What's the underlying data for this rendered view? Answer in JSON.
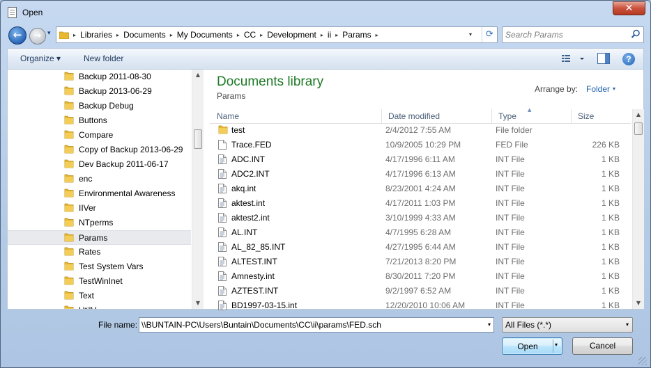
{
  "window": {
    "title": "Open",
    "close_label": "✕"
  },
  "nav": {
    "back_glyph": "←",
    "forward_glyph": "→",
    "recent_glyph": "▾",
    "refresh_glyph": "⟳",
    "dropdown_glyph": "▾"
  },
  "breadcrumb": [
    "Libraries",
    "Documents",
    "My Documents",
    "CC",
    "Development",
    "ii",
    "Params"
  ],
  "search": {
    "placeholder": "Search Params"
  },
  "toolbar": {
    "organize_label": "Organize ▾",
    "new_folder_label": "New folder",
    "help_label": "?"
  },
  "navpane": {
    "items": [
      "Backup 2011-08-30",
      "Backup 2013-06-29",
      "Backup Debug",
      "Buttons",
      "Compare",
      "Copy of Backup 2013-06-29",
      "Dev Backup 2011-06-17",
      "enc",
      "Environmental Awareness",
      "IIVer",
      "NTperms",
      "Params",
      "Rates",
      "Test System Vars",
      "TestWinInet",
      "Text",
      "UtilV..."
    ],
    "selected_index": 11
  },
  "library": {
    "title": "Documents library",
    "subtitle": "Params",
    "arrange_label": "Arrange by:",
    "arrange_value": "Folder"
  },
  "columns": {
    "name": "Name",
    "date": "Date modified",
    "type": "Type",
    "size": "Size"
  },
  "files": [
    {
      "name": "test",
      "date": "2/4/2012 7:55 AM",
      "type": "File folder",
      "size": "",
      "icon": "folder-icon"
    },
    {
      "name": "Trace.FED",
      "date": "10/9/2005 10:29 PM",
      "type": "FED File",
      "size": "226 KB",
      "icon": "blank-file-icon"
    },
    {
      "name": "ADC.INT",
      "date": "4/17/1996 6:11 AM",
      "type": "INT File",
      "size": "1 KB",
      "icon": "text-file-icon"
    },
    {
      "name": "ADC2.INT",
      "date": "4/17/1996 6:13 AM",
      "type": "INT File",
      "size": "1 KB",
      "icon": "text-file-icon"
    },
    {
      "name": "akq.int",
      "date": "8/23/2001 4:24 AM",
      "type": "INT File",
      "size": "1 KB",
      "icon": "text-file-icon"
    },
    {
      "name": "aktest.int",
      "date": "4/17/2011 1:03 PM",
      "type": "INT File",
      "size": "1 KB",
      "icon": "text-file-icon"
    },
    {
      "name": "aktest2.int",
      "date": "3/10/1999 4:33 AM",
      "type": "INT File",
      "size": "1 KB",
      "icon": "text-file-icon"
    },
    {
      "name": "AL.INT",
      "date": "4/7/1995 6:28 AM",
      "type": "INT File",
      "size": "1 KB",
      "icon": "text-file-icon"
    },
    {
      "name": "AL_82_85.INT",
      "date": "4/27/1995 6:44 AM",
      "type": "INT File",
      "size": "1 KB",
      "icon": "text-file-icon"
    },
    {
      "name": "ALTEST.INT",
      "date": "7/21/2013 8:20 PM",
      "type": "INT File",
      "size": "1 KB",
      "icon": "text-file-icon"
    },
    {
      "name": "Amnesty.int",
      "date": "8/30/2011 7:20 PM",
      "type": "INT File",
      "size": "1 KB",
      "icon": "text-file-icon"
    },
    {
      "name": "AZTEST.INT",
      "date": "9/2/1997 6:52 AM",
      "type": "INT File",
      "size": "1 KB",
      "icon": "text-file-icon"
    },
    {
      "name": "BD1997-03-15.int",
      "date": "12/20/2010 10:06 AM",
      "type": "INT File",
      "size": "1 KB",
      "icon": "text-file-icon"
    }
  ],
  "filename": {
    "label": "File name:",
    "value": "\\\\BUNTAIN-PC\\Users\\Buntain\\Documents\\CC\\ii\\params\\FED.sch"
  },
  "filetype": {
    "value": "All Files (*.*)"
  },
  "buttons": {
    "open_label": "Open",
    "cancel_label": "Cancel"
  },
  "colors": {
    "library_title": "#1f7a27",
    "link_blue": "#1f5fb0",
    "folder_yellow": "#e8b930",
    "selected_bg": "#e8eaed"
  }
}
